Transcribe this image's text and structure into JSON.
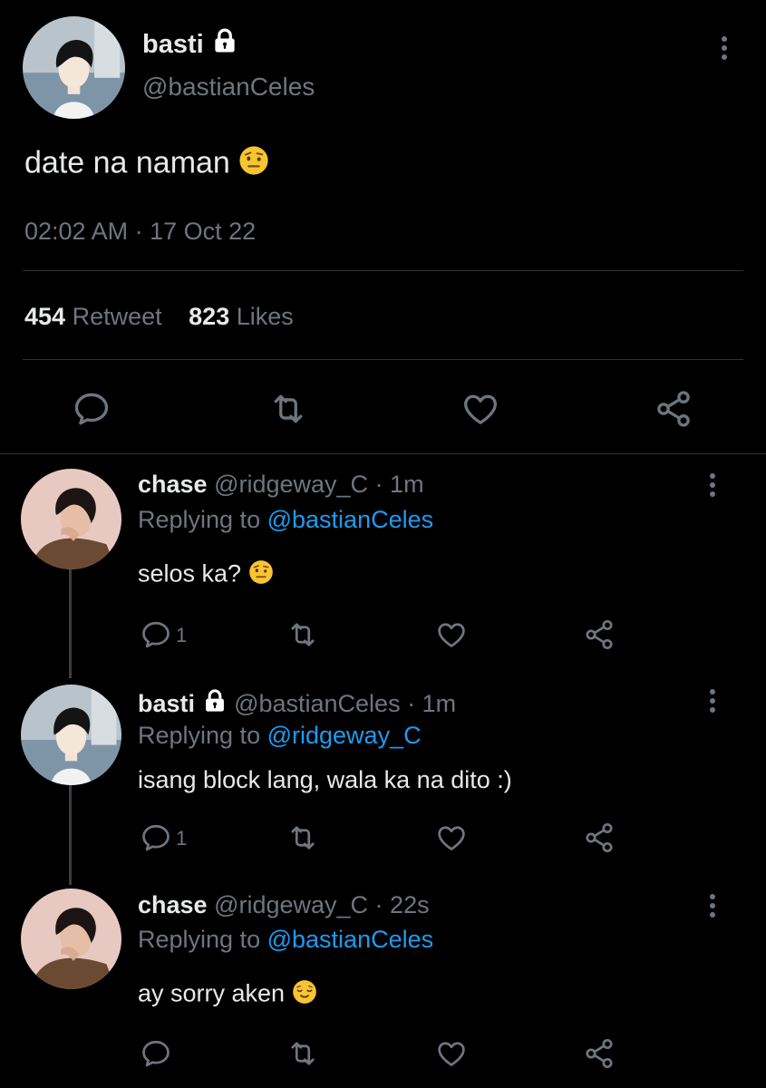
{
  "main_tweet": {
    "display_name": "basti",
    "handle": "@bastianCeles",
    "text": "date na naman",
    "timestamp": "02:02 AM · 17 Oct 22",
    "retweet_count": "454",
    "retweet_label": "Retweet",
    "like_count": "823",
    "like_label": "Likes"
  },
  "replies": [
    {
      "display_name": "chase",
      "meta": "@ridgeway_C · 1m",
      "replying_label": "Replying to",
      "replying_to": "@bastianCeles",
      "text": "selos ka?",
      "reply_count": "1"
    },
    {
      "display_name": "basti",
      "meta": "@bastianCeles · 1m",
      "replying_label": "Replying to",
      "replying_to": "@ridgeway_C",
      "text": "isang block lang, wala ka na dito :)",
      "reply_count": "1"
    },
    {
      "display_name": "chase",
      "meta": "@ridgeway_C · 22s",
      "replying_label": "Replying to",
      "replying_to": "@bastianCeles",
      "text": "ay sorry aken",
      "reply_count": ""
    }
  ],
  "colors": {
    "background": "#000000",
    "text": "#e7e9ea",
    "muted": "#6e767d",
    "link": "#1d9bf0",
    "divider": "#2f3336"
  },
  "icons": [
    "lock-icon",
    "more-options-icon",
    "reply-icon",
    "retweet-icon",
    "like-icon",
    "share-icon",
    "raised-eyebrow-emoji",
    "relieved-face-emoji"
  ]
}
